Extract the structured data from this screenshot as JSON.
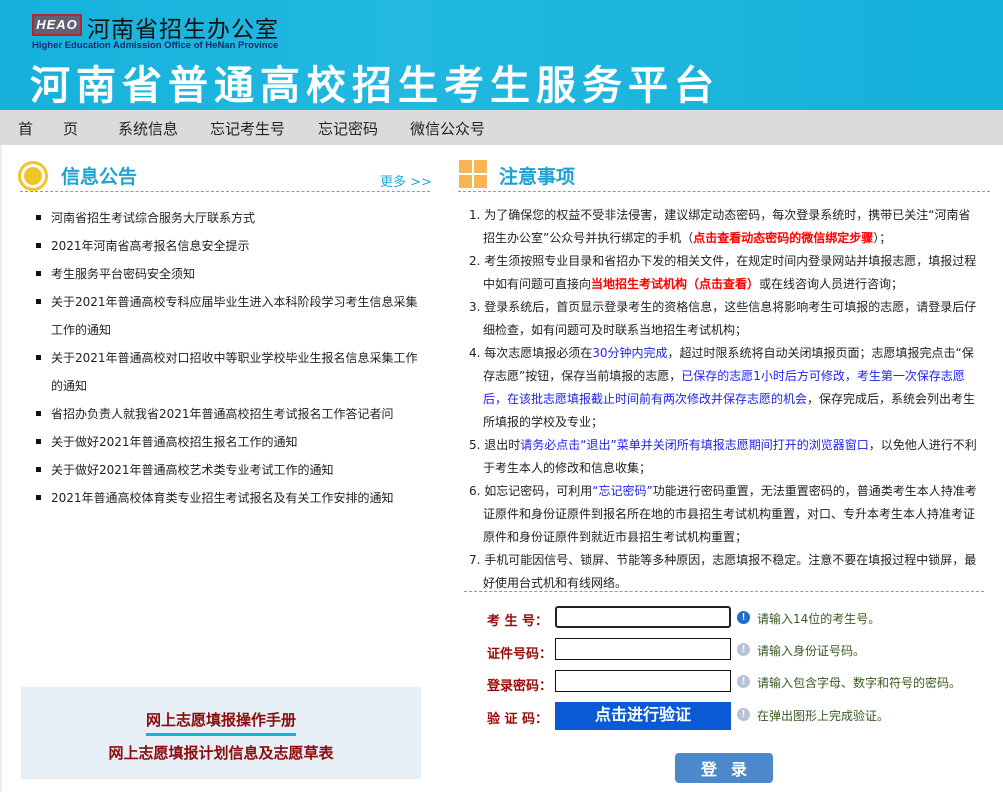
{
  "header": {
    "logo_text": "HEAO",
    "office": "河南省招生办公室",
    "office_en": "Higher Education Admission Office of HeNan Province",
    "platform": "河南省普通高校招生考生服务平台"
  },
  "nav": [
    "首　　页",
    "系统信息",
    "忘记考生号",
    "忘记密码",
    "微信公众号"
  ],
  "notices": {
    "title": "信息公告",
    "more": "更多 >>",
    "items": [
      "河南省招生考试综合服务大厅联系方式",
      "2021年河南省高考报名信息安全提示",
      "考生服务平台密码安全须知",
      "关于2021年普通高校专科应届毕业生进入本科阶段学习考生信息采集工作的通知",
      "关于2021年普通高校对口招收中等职业学校毕业生报名信息采集工作的通知",
      "省招办负责人就我省2021年普通高校招生考试报名工作答记者问",
      "关于做好2021年普通高校招生报名工作的通知",
      "关于做好2021年普通高校艺术类专业考试工作的通知",
      "2021年普通高校体育类专业招生考试报名及有关工作安排的通知"
    ]
  },
  "notes": {
    "title": "注意事项",
    "items": [
      [
        {
          "t": "1. 为了确保您的权益不受非法侵害，建议绑定动态密码，每次登录系统时，携带已关注“河南省招生办公室”公众号并执行绑定的手机（"
        },
        {
          "t": "点击查看动态密码的微信绑定步骤",
          "c": "red",
          "link": true
        },
        {
          "t": "）；"
        }
      ],
      [
        {
          "t": "2. 考生须按照专业目录和省招办下发的相关文件，在规定时间内登录网站并填报志愿，填报过程中如有问题可直接向"
        },
        {
          "t": "当地招生考试机构（点击查看）",
          "c": "red",
          "link": true
        },
        {
          "t": "或在线咨询人员进行咨询；"
        }
      ],
      [
        {
          "t": "3. 登录系统后，首页显示登录考生的资格信息，这些信息将影响考生可填报的志愿，请登录后仔细检查，如有问题可及时联系当地招生考试机构；"
        }
      ],
      [
        {
          "t": "4. 每次志愿填报必须在"
        },
        {
          "t": "30分钟内完成",
          "c": "blue"
        },
        {
          "t": "，超过时限系统将自动关闭填报页面；志愿填报完点击“保存志愿”按钮，保存当前填报的志愿，"
        },
        {
          "t": "已保存的志愿1小时后方可修改，考生第一次保存志愿后，在该批志愿填报截止时间前有两次修改并保存志愿的机会",
          "c": "blue"
        },
        {
          "t": "，保存完成后，系统会列出考生所填报的学校及专业；"
        }
      ],
      [
        {
          "t": "5. 退出时"
        },
        {
          "t": "请务必点击“退出”菜单并关闭所有填报志愿期间打开的浏览器窗口",
          "c": "blue"
        },
        {
          "t": "，以免他人进行不利于考生本人的修改和信息收集；"
        }
      ],
      [
        {
          "t": "6. 如忘记密码，可利用"
        },
        {
          "t": "“忘记密码”",
          "c": "blue"
        },
        {
          "t": "功能进行密码重置，无法重置密码的，普通类考生本人持准考证原件和身份证原件到报名所在地的市县招生考试机构重置，对口、专升本考生本人持准考证原件和身份证原件到就近市县招生考试机构重置；"
        }
      ],
      [
        {
          "t": "7. 手机可能因信号、锁屏、节能等多种原因，志愿填报不稳定。注意不要在填报过程中锁屏，最好使用台式机和有线网络。"
        }
      ]
    ]
  },
  "form": {
    "exam_no": {
      "label": "考 生 号：",
      "value": "",
      "hint": "请输入14位的考生号。"
    },
    "id_no": {
      "label": "证件号码：",
      "value": "",
      "hint": "请输入身份证号码。"
    },
    "password": {
      "label": "登录密码：",
      "value": "",
      "hint": "请输入包含字母、数字和符号的密码。"
    },
    "captcha": {
      "label": "验 证 码：",
      "button": "点击进行验证",
      "hint": "在弹出图形上完成验证。"
    },
    "login": "登录"
  },
  "guide": {
    "manual": "网上志愿填报操作手册",
    "plan": "网上志愿填报计划信息及志愿草表"
  }
}
